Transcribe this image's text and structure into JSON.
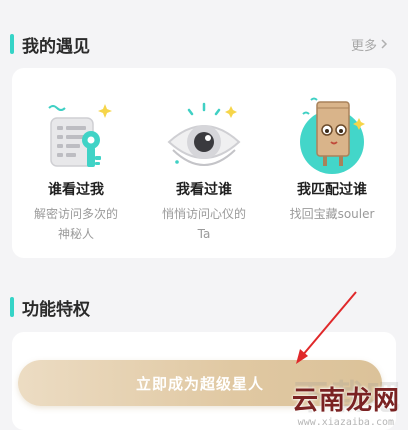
{
  "encounters": {
    "title": "我的遇见",
    "more_label": "更多",
    "features": [
      {
        "title": "谁看过我",
        "desc": "解密访问多次的神秘人",
        "icon": "document-key-icon"
      },
      {
        "title": "我看过谁",
        "desc": "悄悄访问心仪的Ta",
        "icon": "eye-icon"
      },
      {
        "title": "我匹配过谁",
        "desc": "找回宝藏souler",
        "icon": "paper-bag-avatar-icon"
      }
    ]
  },
  "privileges": {
    "title": "功能特权"
  },
  "cta": {
    "label": "立即成为超级星人"
  },
  "watermark": {
    "text": "云南龙网",
    "url": "www.xiazaiba.com"
  },
  "colors": {
    "accent": "#35d4c7",
    "cta_gold": "#e0c8a2",
    "annotation_arrow": "#e0282a"
  }
}
